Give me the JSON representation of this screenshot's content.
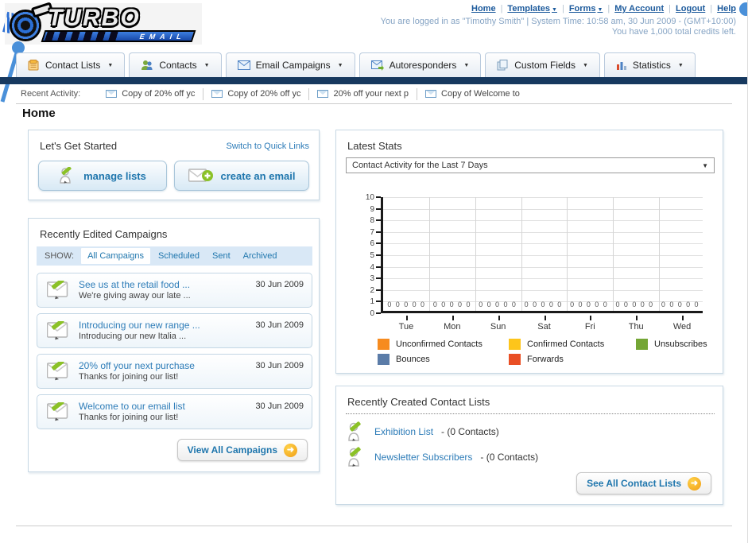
{
  "header": {
    "logo_title": "TURBO",
    "logo_subtitle": "EMAIL",
    "nav_links": [
      {
        "label": "Home",
        "dropdown": false
      },
      {
        "label": "Templates",
        "dropdown": true
      },
      {
        "label": "Forms",
        "dropdown": true
      },
      {
        "label": "My Account",
        "dropdown": false
      },
      {
        "label": "Logout",
        "dropdown": false
      },
      {
        "label": "Help",
        "dropdown": false
      }
    ],
    "login_info": "You are logged in as \"Timothy Smith\" | System Time: 10:58 am, 30 Jun 2009 - (GMT+10:00)",
    "credits_info": "You have 1,000 total credits left."
  },
  "tabs": [
    {
      "label": "Contact Lists"
    },
    {
      "label": "Contacts"
    },
    {
      "label": "Email Campaigns"
    },
    {
      "label": "Autoresponders"
    },
    {
      "label": "Custom Fields"
    },
    {
      "label": "Statistics"
    }
  ],
  "recent_activity": {
    "label": "Recent Activity:",
    "items": [
      {
        "text": "Copy of 20% off yc"
      },
      {
        "text": "Copy of 20% off yc"
      },
      {
        "text": "20% off your next p"
      },
      {
        "text": "Copy of Welcome to"
      }
    ]
  },
  "page_title": "Home",
  "get_started": {
    "title": "Let's Get Started",
    "switch_link": "Switch to Quick Links",
    "manage_lists_label": "manage lists",
    "create_email_label": "create an email"
  },
  "campaigns": {
    "title": "Recently Edited Campaigns",
    "show_label": "SHOW:",
    "filters": [
      {
        "label": "All Campaigns",
        "active": true
      },
      {
        "label": "Scheduled",
        "active": false
      },
      {
        "label": "Sent",
        "active": false
      },
      {
        "label": "Archived",
        "active": false
      }
    ],
    "items": [
      {
        "title": "See us at the retail food ...",
        "subtitle": "We're giving away our late ...",
        "date": "30 Jun 2009"
      },
      {
        "title": "Introducing our new range ...",
        "subtitle": "Introducing our new Italia ...",
        "date": "30 Jun 2009"
      },
      {
        "title": "20% off your next purchase",
        "subtitle": "Thanks for joining our list!",
        "date": "30 Jun 2009"
      },
      {
        "title": "Welcome to our email list",
        "subtitle": "Thanks for joining our list!",
        "date": "30 Jun 2009"
      }
    ],
    "view_all_label": "View All Campaigns"
  },
  "stats": {
    "title": "Latest Stats",
    "dropdown_value": "Contact Activity for the Last 7 Days"
  },
  "chart_data": {
    "type": "bar",
    "title": "Contact Activity for the Last 7 Days",
    "categories": [
      "Tue",
      "Mon",
      "Sun",
      "Sat",
      "Fri",
      "Thu",
      "Wed"
    ],
    "series": [
      {
        "name": "Unconfirmed Contacts",
        "color": "#f68b1f",
        "values": [
          0,
          0,
          0,
          0,
          0,
          0,
          0
        ]
      },
      {
        "name": "Confirmed Contacts",
        "color": "#fdc51b",
        "values": [
          0,
          0,
          0,
          0,
          0,
          0,
          0
        ]
      },
      {
        "name": "Unsubscribes",
        "color": "#74a635",
        "values": [
          0,
          0,
          0,
          0,
          0,
          0,
          0
        ]
      },
      {
        "name": "Bounces",
        "color": "#5b7ca8",
        "values": [
          0,
          0,
          0,
          0,
          0,
          0,
          0
        ]
      },
      {
        "name": "Forwards",
        "color": "#e94f25",
        "values": [
          0,
          0,
          0,
          0,
          0,
          0,
          0
        ]
      }
    ],
    "ylim": [
      0,
      10
    ],
    "y_tick_step": 1,
    "value_labels": "0",
    "grid": true,
    "legend_position": "bottom"
  },
  "contact_lists": {
    "title": "Recently Created Contact Lists",
    "items": [
      {
        "name": "Exhibition List",
        "count": "- (0 Contacts)"
      },
      {
        "name": "Newsletter Subscribers",
        "count": "- (0 Contacts)"
      }
    ],
    "see_all_label": "See All Contact Lists"
  }
}
